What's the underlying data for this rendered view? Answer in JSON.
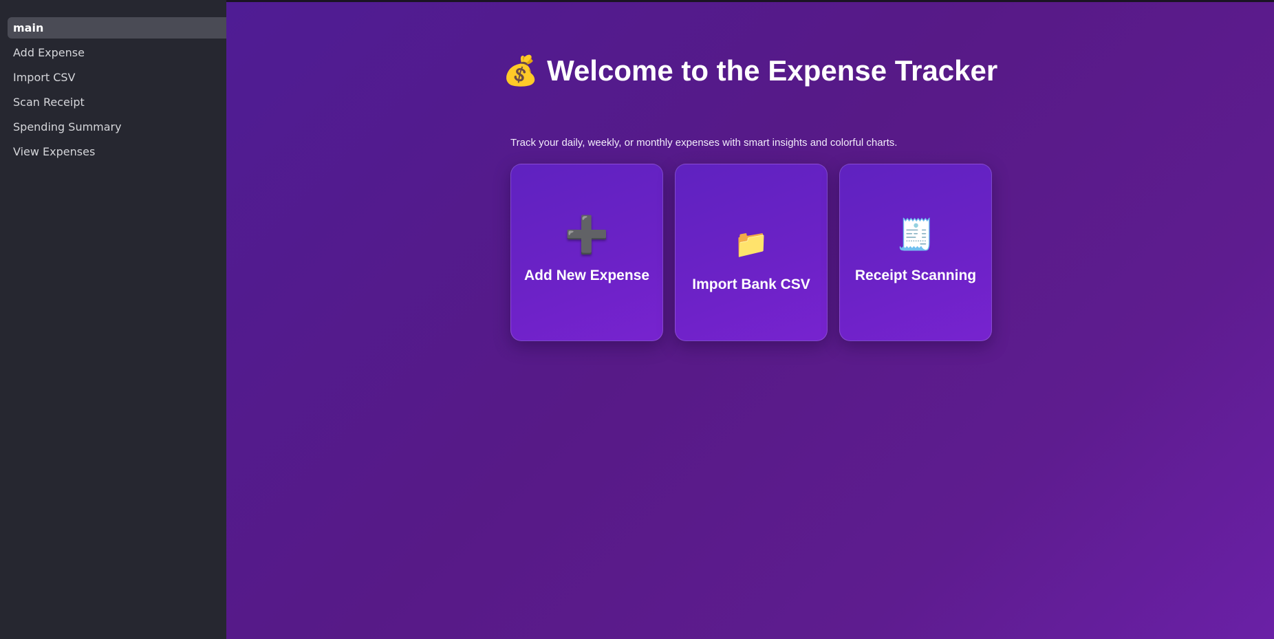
{
  "sidebar": {
    "items": [
      {
        "label": "main",
        "active": true
      },
      {
        "label": "Add Expense"
      },
      {
        "label": "Import CSV"
      },
      {
        "label": "Scan Receipt"
      },
      {
        "label": "Spending Summary"
      },
      {
        "label": "View Expenses"
      }
    ]
  },
  "main": {
    "title_icon": "money-bag-icon",
    "title_emoji": "💰",
    "title": "Welcome to the Expense Tracker",
    "subtitle": "Track your daily, weekly, or monthly expenses with smart insights and colorful charts.",
    "cards": [
      {
        "icon": "plus-icon",
        "glyph": "➕",
        "label": "Add New Expense"
      },
      {
        "icon": "folder-icon",
        "glyph": "📁",
        "label": "Import Bank CSV"
      },
      {
        "icon": "receipt-icon",
        "glyph": "🧾",
        "label": "Receipt Scanning"
      }
    ]
  },
  "colors": {
    "sidebar_bg": "#262730",
    "active_item_bg": "#4a4b55",
    "main_gradient_start": "#4f1c94",
    "main_gradient_end": "#6a20a6",
    "card_bg": "#6b22c6"
  }
}
